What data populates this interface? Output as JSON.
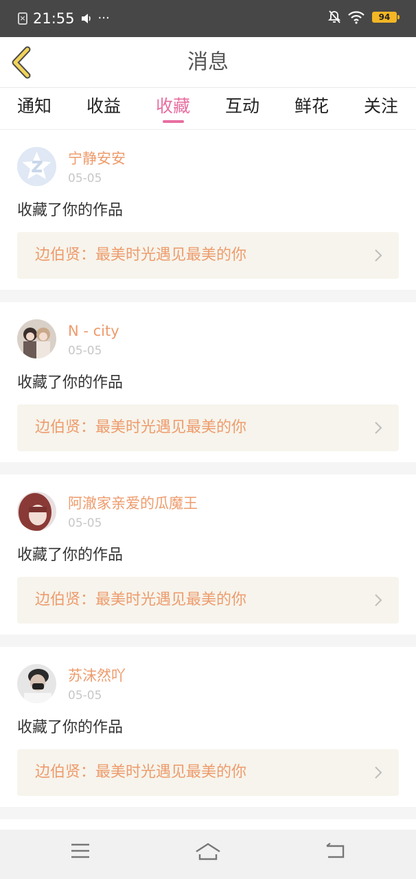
{
  "status_bar": {
    "time": "21:55",
    "battery": "94",
    "notif_icon": "close-box-icon",
    "sound_icon": "volume-icon",
    "more": "···"
  },
  "header": {
    "title": "消息"
  },
  "tabs": [
    {
      "label": "通知",
      "active": false
    },
    {
      "label": "收益",
      "active": false
    },
    {
      "label": "收藏",
      "active": true
    },
    {
      "label": "互动",
      "active": false
    },
    {
      "label": "鲜花",
      "active": false
    },
    {
      "label": "关注",
      "active": false
    }
  ],
  "notifications": [
    {
      "username": "宁静安安",
      "date": "05-05",
      "message": "收藏了你的作品",
      "work": "边伯贤：最美时光遇见最美的你",
      "avatar": "default-avatar"
    },
    {
      "username": "N - city",
      "date": "05-05",
      "message": "收藏了你的作品",
      "work": "边伯贤：最美时光遇见最美的你",
      "avatar": "photo-avatar"
    },
    {
      "username": "阿澈家亲爱的瓜魔王",
      "date": "05-05",
      "message": "收藏了你的作品",
      "work": "边伯贤：最美时光遇见最美的你",
      "avatar": "photo-avatar"
    },
    {
      "username": "苏沫然吖",
      "date": "05-05",
      "message": "收藏了你的作品",
      "work": "边伯贤：最美时光遇见最美的你",
      "avatar": "photo-avatar"
    }
  ],
  "colors": {
    "accent": "#e86ea0",
    "name": "#ee9b6c",
    "back_arrow": "#f2d35a"
  }
}
